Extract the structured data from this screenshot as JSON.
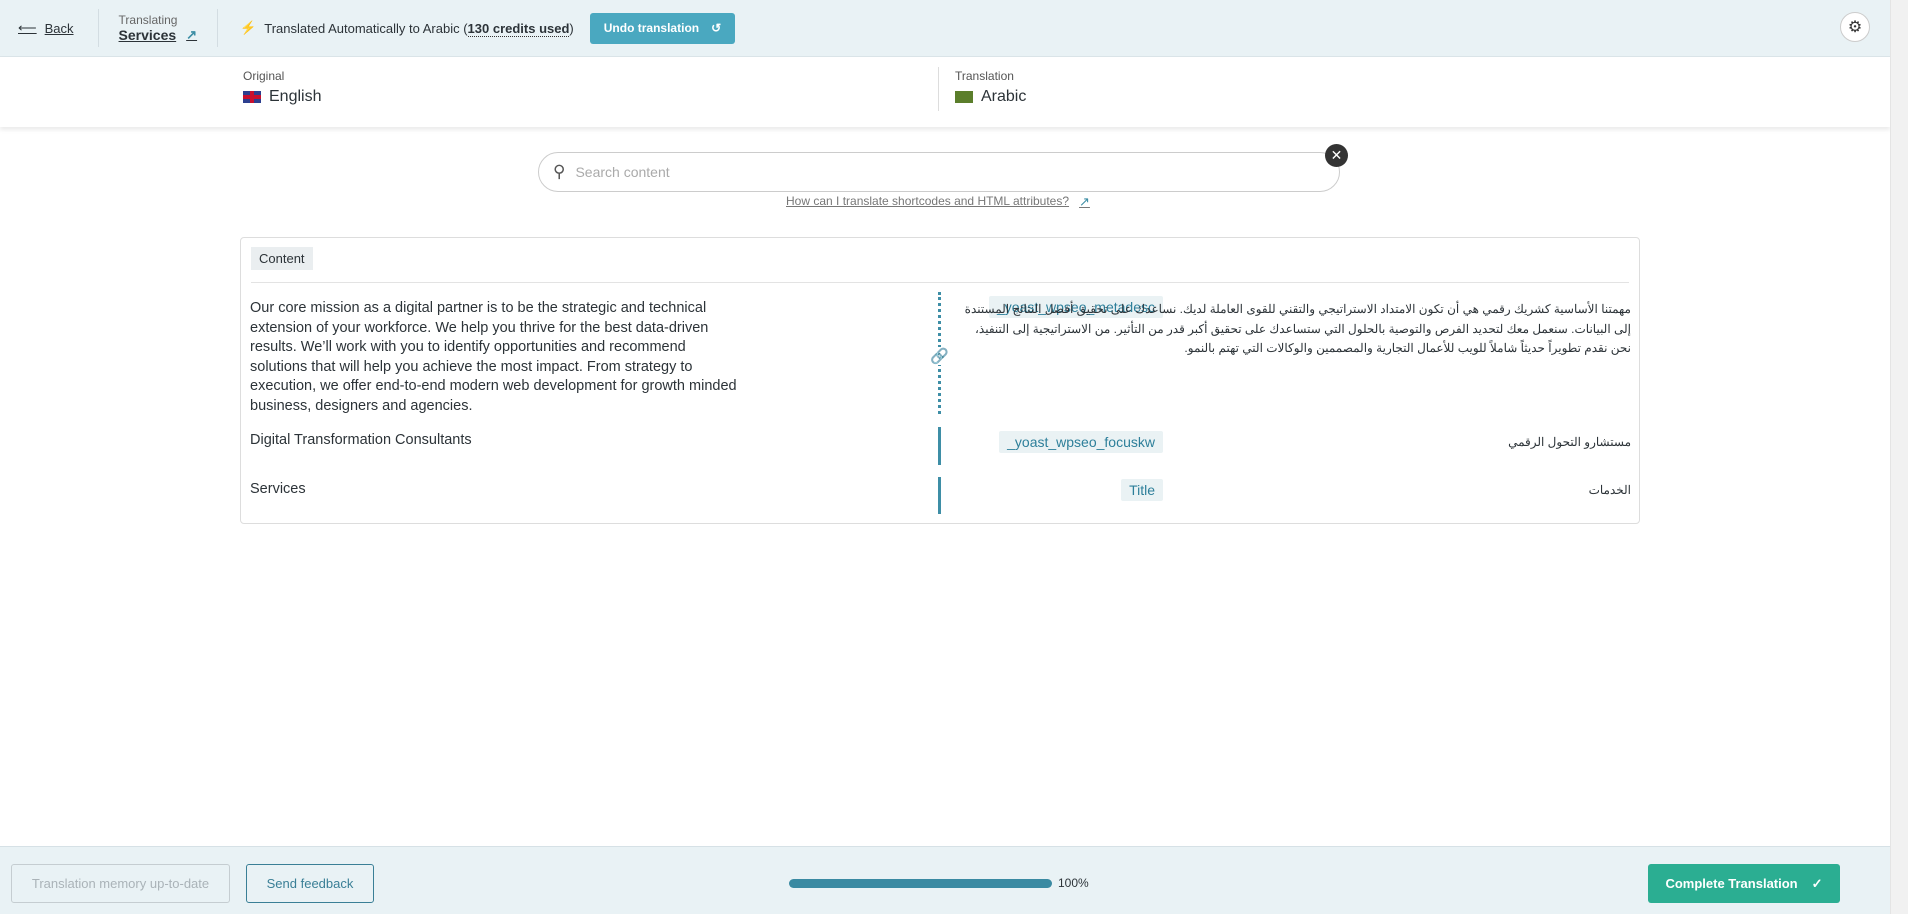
{
  "header": {
    "back": "Back",
    "translating_label": "Translating",
    "page_title": "Services",
    "auto_text": "Translated Automatically to Arabic (",
    "credits": "130 credits used",
    "auto_close": ")",
    "undo": "Undo translation"
  },
  "languages": {
    "original_label": "Original",
    "original": "English",
    "translation_label": "Translation",
    "translation": "Arabic"
  },
  "search": {
    "placeholder": "Search content",
    "help_link": "How can I translate shortcodes and HTML attributes?"
  },
  "content": {
    "section_label": "Content",
    "rows": [
      {
        "source": "Our core mission as a digital partner is to be the strategic and technical extension of your workforce. We help you thrive for the best data-driven results. We’ll work with you to identify opportunities and recommend solutions that will help you achieve the most impact. From strategy to execution, we offer end-to-end modern web development for growth minded business, designers and agencies.",
        "field": "_yoast_wpseo_metadesc",
        "target": "مهمتنا الأساسية كشريك رقمي هي أن تكون الامتداد الاستراتيجي والتقني للقوى العاملة لديك. نساعدك على تحقيق أفضل النتائج المستندة إلى البيانات. سنعمل معك لتحديد الفرص والتوصية بالحلول التي ستساعدك على تحقيق أكبر قدر من التأثير. من الاستراتيجية إلى التنفيذ، نحن نقدم تطويراً حديثاً شاملاً للويب للأعمال التجارية والمصممين والوكالات التي تهتم بالنمو."
      },
      {
        "source": "Digital Transformation Consultants",
        "field": "_yoast_wpseo_focuskw",
        "target": "مستشارو التحول الرقمي"
      },
      {
        "source": "Services",
        "field": "Title",
        "target": "الخدمات"
      }
    ]
  },
  "footer": {
    "memory": "Translation memory up-to-date",
    "feedback": "Send feedback",
    "progress_percent": 100,
    "progress_label": "100%",
    "complete": "Complete Translation"
  }
}
